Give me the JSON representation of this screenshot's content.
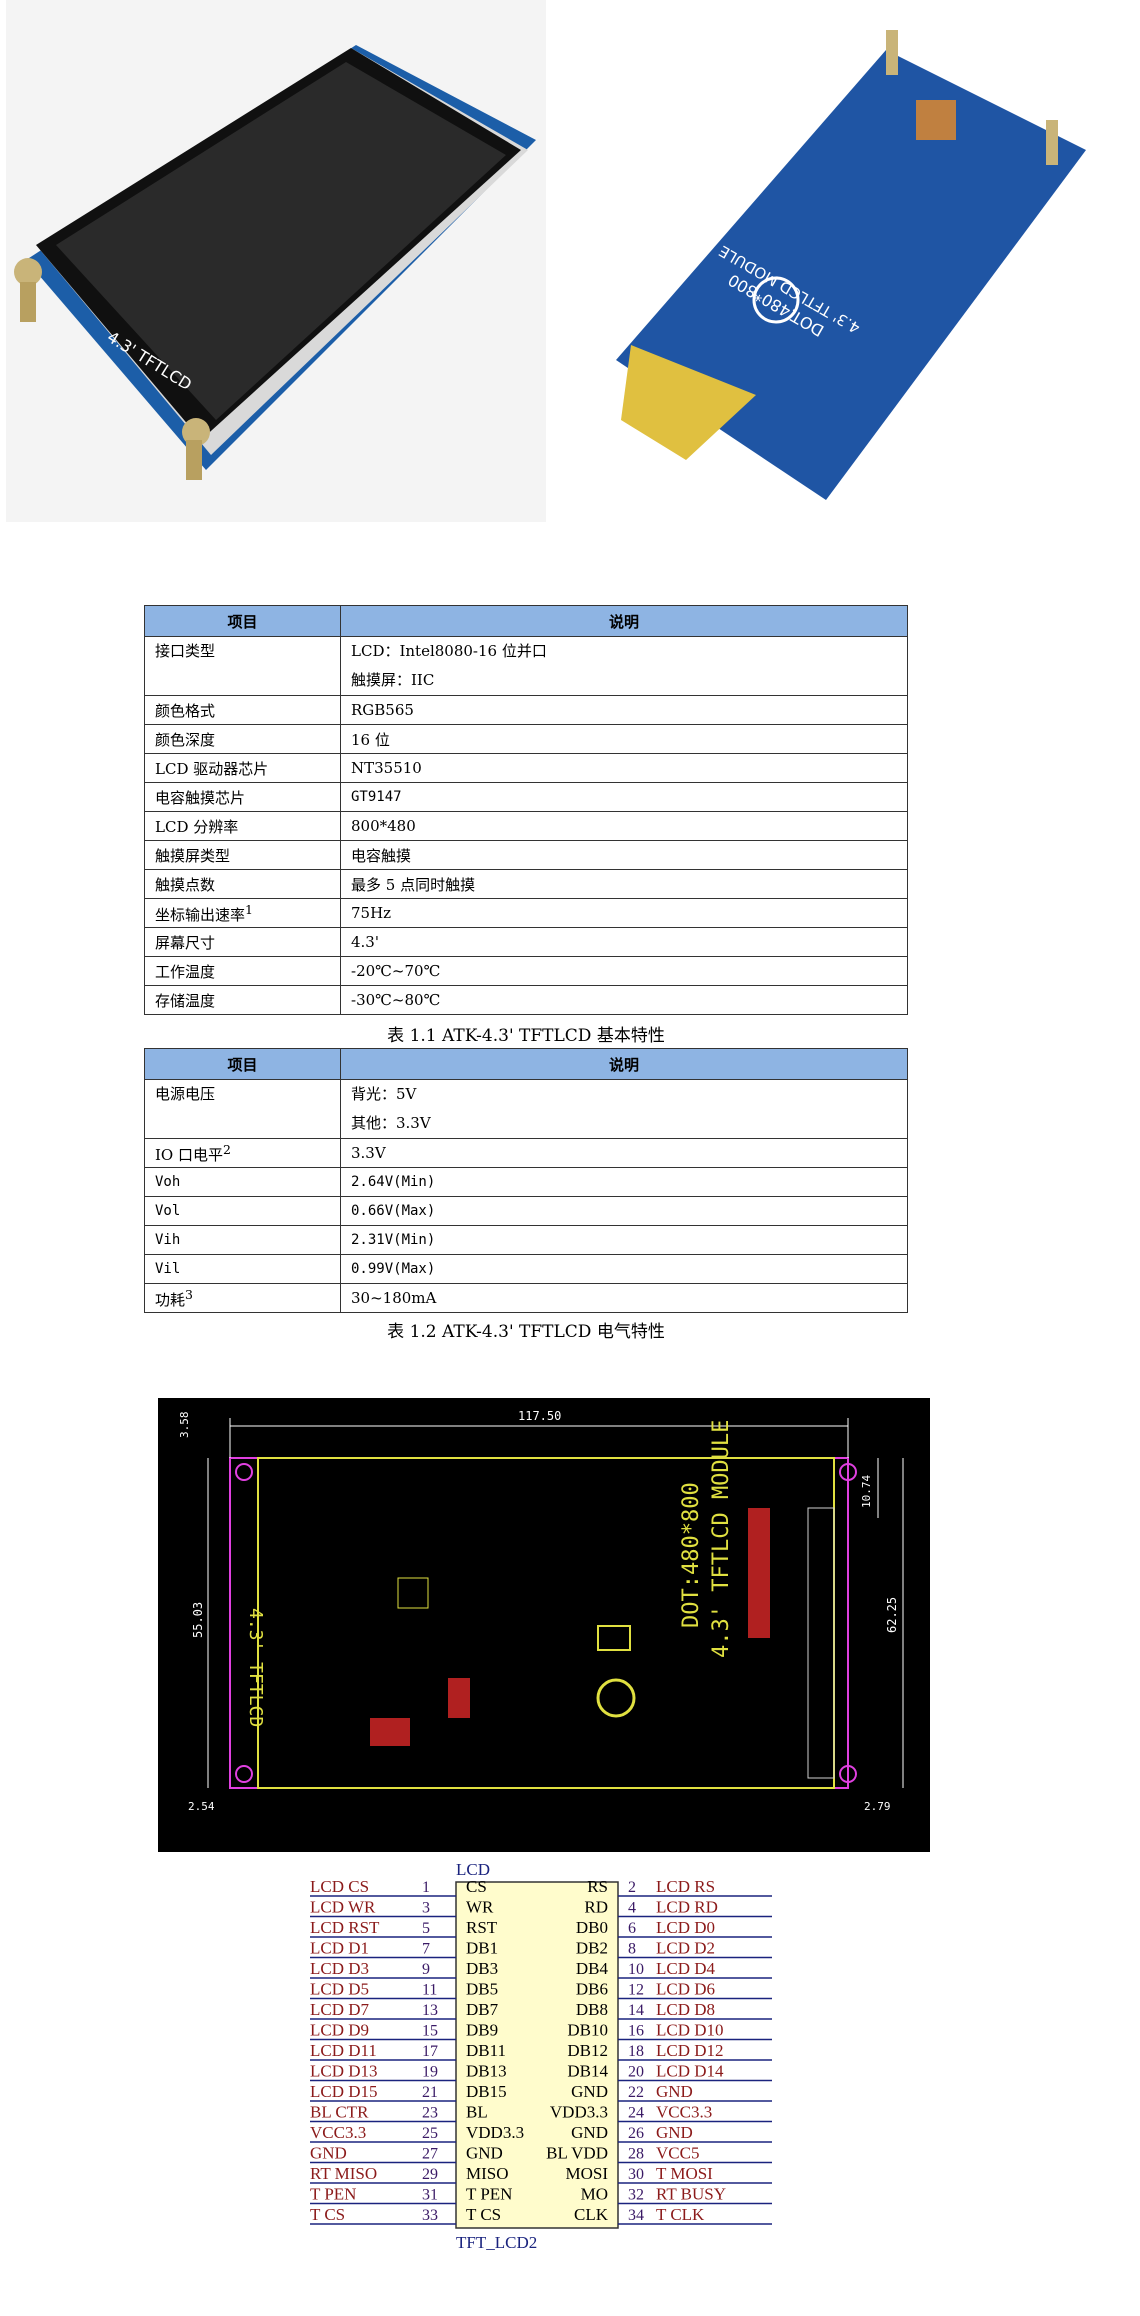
{
  "photos": {
    "front_label": "4.3' TFTLCD",
    "back_label_1": "DOT:480*800",
    "back_label_2": "4.3' TFTLCD MODULE"
  },
  "table1": {
    "headers": [
      "项目",
      "说明"
    ],
    "rows": [
      {
        "item": "接口类型",
        "desc": [
          "LCD：Intel8080-16 位并口",
          "触摸屏：IIC"
        ]
      },
      {
        "item": "颜色格式",
        "desc": [
          "RGB565"
        ]
      },
      {
        "item": "颜色深度",
        "desc": [
          "16 位"
        ]
      },
      {
        "item": "LCD 驱动器芯片",
        "desc": [
          "NT35510"
        ]
      },
      {
        "item": "电容触摸芯片",
        "desc": [
          "GT9147"
        ]
      },
      {
        "item": "LCD 分辨率",
        "desc": [
          "800*480"
        ]
      },
      {
        "item": "触摸屏类型",
        "desc": [
          "电容触摸"
        ]
      },
      {
        "item": "触摸点数",
        "desc": [
          "最多 5 点同时触摸"
        ]
      },
      {
        "item": "坐标输出速率",
        "sup": "1",
        "desc": [
          "75Hz"
        ]
      },
      {
        "item": "屏幕尺寸",
        "desc": [
          "4.3'"
        ]
      },
      {
        "item": "工作温度",
        "desc": [
          "-20℃~70℃"
        ]
      },
      {
        "item": "存储温度",
        "desc": [
          "-30℃~80℃"
        ]
      }
    ],
    "caption": "表 1.1 ATK-4.3' TFTLCD  基本特性"
  },
  "table2": {
    "headers": [
      "项目",
      "说明"
    ],
    "rows": [
      {
        "item": "电源电压",
        "desc": [
          "背光：5V",
          "其他：3.3V"
        ]
      },
      {
        "item": "IO 口电平",
        "sup": "2",
        "desc": [
          "3.3V"
        ]
      },
      {
        "item": "Voh",
        "desc": [
          "2.64V(Min)"
        ]
      },
      {
        "item": "Vol",
        "desc": [
          "0.66V(Max)"
        ]
      },
      {
        "item": "Vih",
        "desc": [
          "2.31V(Min)"
        ]
      },
      {
        "item": "Vil",
        "desc": [
          "0.99V(Max)"
        ]
      },
      {
        "item": "功耗",
        "sup": "3",
        "desc": [
          "30~180mA"
        ]
      }
    ],
    "caption": "表 1.2 ATK-4.3' TFTLCD  电气特性"
  },
  "cad": {
    "dim_top": "117.50",
    "dim_top_left": "3.58",
    "dim_left": "55.03",
    "dim_right_top": "10.74",
    "dim_right": "62.25",
    "dim_bottom_left": "2.54",
    "dim_bottom_right": "2.79",
    "silk_left": "4.3' TFTLCD",
    "silk_right_1": "DOT:480*800",
    "silk_right_2": "4.3' TFTLCD MODULE"
  },
  "schematic": {
    "ref": "LCD",
    "part": "TFT_LCD2",
    "rows": [
      {
        "ln": "LCD_CS",
        "lp": "1",
        "li": "CS",
        "ri": "RS",
        "rp": "2",
        "rn": "LCD_RS"
      },
      {
        "ln": "LCD_WR",
        "lp": "3",
        "li": "WR",
        "ri": "RD",
        "rp": "4",
        "rn": "LCD_RD"
      },
      {
        "ln": "LCD_RST",
        "lp": "5",
        "li": "RST",
        "ri": "DB0",
        "rp": "6",
        "rn": "LCD_D0"
      },
      {
        "ln": "LCD_D1",
        "lp": "7",
        "li": "DB1",
        "ri": "DB2",
        "rp": "8",
        "rn": "LCD_D2"
      },
      {
        "ln": "LCD_D3",
        "lp": "9",
        "li": "DB3",
        "ri": "DB4",
        "rp": "10",
        "rn": "LCD_D4"
      },
      {
        "ln": "LCD_D5",
        "lp": "11",
        "li": "DB5",
        "ri": "DB6",
        "rp": "12",
        "rn": "LCD_D6"
      },
      {
        "ln": "LCD_D7",
        "lp": "13",
        "li": "DB7",
        "ri": "DB8",
        "rp": "14",
        "rn": "LCD_D8"
      },
      {
        "ln": "LCD_D9",
        "lp": "15",
        "li": "DB9",
        "ri": "DB10",
        "rp": "16",
        "rn": "LCD_D10"
      },
      {
        "ln": "LCD_D11",
        "lp": "17",
        "li": "DB11",
        "ri": "DB12",
        "rp": "18",
        "rn": "LCD_D12"
      },
      {
        "ln": "LCD_D13",
        "lp": "19",
        "li": "DB13",
        "ri": "DB14",
        "rp": "20",
        "rn": "LCD_D14"
      },
      {
        "ln": "LCD_D15",
        "lp": "21",
        "li": "DB15",
        "ri": "GND",
        "rp": "22",
        "rn": "GND"
      },
      {
        "ln": "BL_CTR",
        "lp": "23",
        "li": "BL",
        "ri": "VDD3.3",
        "rp": "24",
        "rn": "VCC3.3"
      },
      {
        "ln": "VCC3.3",
        "lp": "25",
        "li": "VDD3.3",
        "ri": "GND",
        "rp": "26",
        "rn": "GND"
      },
      {
        "ln": "GND",
        "lp": "27",
        "li": "GND",
        "ri": "BL_VDD",
        "rp": "28",
        "rn": "VCC5"
      },
      {
        "ln": "RT_MISO",
        "lp": "29",
        "li": "MISO",
        "ri": "MOSI",
        "rp": "30",
        "rn": "T_MOSI"
      },
      {
        "ln": "T_PEN",
        "lp": "31",
        "li": "T_PEN",
        "ri": "MO",
        "rp": "32",
        "rn": "RT_BUSY"
      },
      {
        "ln": "T_CS",
        "lp": "33",
        "li": "T_CS",
        "ri": "CLK",
        "rp": "34",
        "rn": "T_CLK"
      }
    ]
  }
}
